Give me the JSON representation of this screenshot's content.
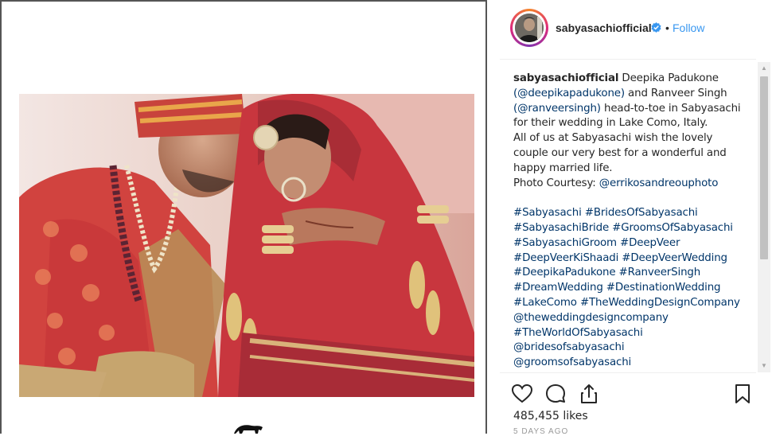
{
  "post": {
    "username": "sabyasachiofficial",
    "follow_label": "Follow",
    "separator": "•",
    "caption_lines": [
      [
        {
          "t": "sabyasachiofficial",
          "k": "user"
        },
        {
          "t": " Deepika Padukone",
          "k": "text"
        }
      ],
      [
        {
          "t": "(@deepikapadukone)",
          "k": "link"
        },
        {
          "t": " and Ranveer Singh",
          "k": "text"
        }
      ],
      [
        {
          "t": "(@ranveersingh)",
          "k": "link"
        },
        {
          "t": " head-to-toe in Sabyasachi",
          "k": "text"
        }
      ],
      [
        {
          "t": "for their wedding in Lake Como, Italy.",
          "k": "text"
        }
      ],
      [
        {
          "t": "All of us at Sabyasachi wish the lovely",
          "k": "text"
        }
      ],
      [
        {
          "t": "couple our very best for a wonderful and",
          "k": "text"
        }
      ],
      [
        {
          "t": "happy married life.",
          "k": "text"
        }
      ],
      [
        {
          "t": "Photo Courtesy: ",
          "k": "text"
        },
        {
          "t": "@errikosandreouphoto",
          "k": "link"
        }
      ],
      [],
      [
        {
          "t": "#Sabyasachi",
          "k": "link"
        },
        {
          "t": " ",
          "k": "text"
        },
        {
          "t": "#BridesOfSabyasachi",
          "k": "link"
        }
      ],
      [
        {
          "t": "#SabyasachiBride",
          "k": "link"
        },
        {
          "t": " ",
          "k": "text"
        },
        {
          "t": "#GroomsOfSabyasachi",
          "k": "link"
        }
      ],
      [
        {
          "t": "#SabyasachiGroom",
          "k": "link"
        },
        {
          "t": " ",
          "k": "text"
        },
        {
          "t": "#DeepVeer",
          "k": "link"
        }
      ],
      [
        {
          "t": "#DeepVeerKiShaadi",
          "k": "link"
        },
        {
          "t": " ",
          "k": "text"
        },
        {
          "t": "#DeepVeerWedding",
          "k": "link"
        }
      ],
      [
        {
          "t": "#DeepikaPadukone",
          "k": "link"
        },
        {
          "t": " ",
          "k": "text"
        },
        {
          "t": "#RanveerSingh",
          "k": "link"
        }
      ],
      [
        {
          "t": "#DreamWedding",
          "k": "link"
        },
        {
          "t": " ",
          "k": "text"
        },
        {
          "t": "#DestinationWedding",
          "k": "link"
        }
      ],
      [
        {
          "t": "#LakeComo",
          "k": "link"
        },
        {
          "t": " ",
          "k": "text"
        },
        {
          "t": "#TheWeddingDesignCompany",
          "k": "link"
        }
      ],
      [
        {
          "t": "@theweddingdesigncompany",
          "k": "link"
        }
      ],
      [
        {
          "t": "#TheWorldOfSabyasachi",
          "k": "link"
        }
      ],
      [
        {
          "t": "@bridesofsabyasachi",
          "k": "link"
        }
      ],
      [
        {
          "t": "@groomsofsabyasachi",
          "k": "link"
        }
      ]
    ],
    "likes_label": "485,455 likes",
    "timestamp": "5 DAYS AGO"
  },
  "icons": {
    "like": "heart-icon",
    "comment": "comment-icon",
    "share": "share-icon",
    "save": "bookmark-icon",
    "verified": "verified-badge-icon"
  },
  "colors": {
    "link": "#003569",
    "follow": "#3897f0",
    "text": "#262626"
  }
}
